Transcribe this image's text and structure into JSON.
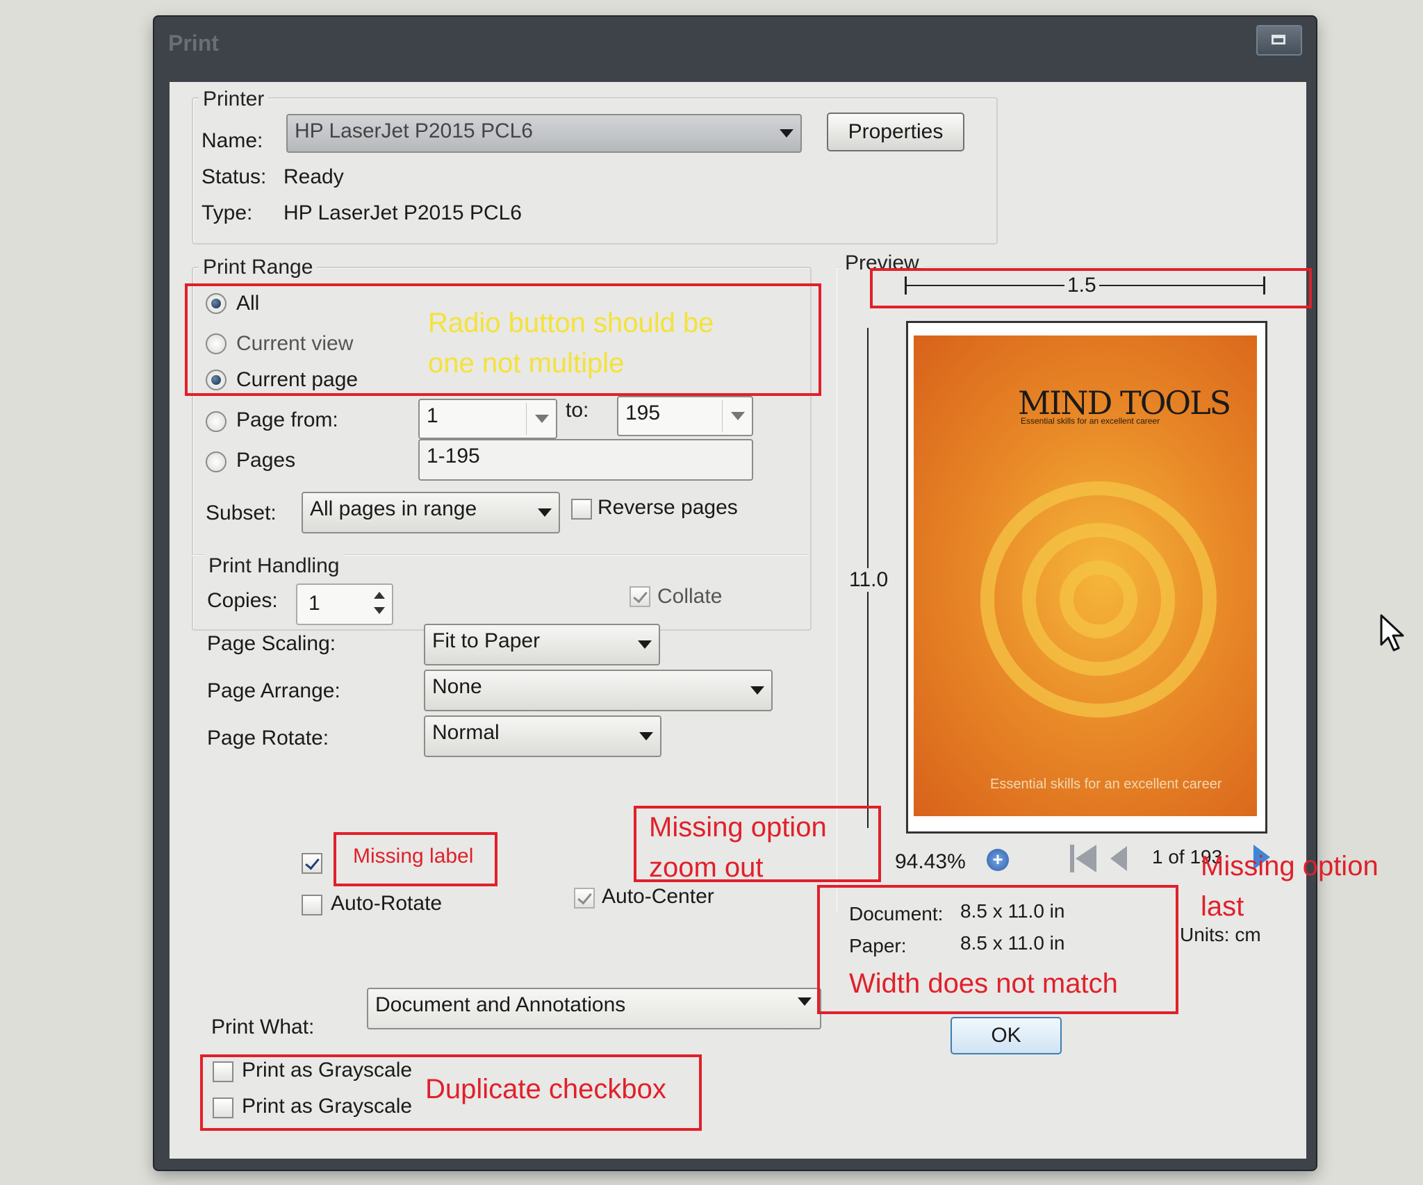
{
  "window": {
    "title": "Print"
  },
  "printer": {
    "group_title": "Printer",
    "name_label": "Name:",
    "name_value": "HP LaserJet P2015 PCL6",
    "properties_label": "Properties",
    "status_label": "Status:",
    "status_value": "Ready",
    "type_label": "Type:",
    "type_value": "HP LaserJet P2015 PCL6"
  },
  "print_range": {
    "group_title": "Print Range",
    "all_label": "All",
    "current_view_label": "Current view",
    "current_page_label": "Current page",
    "page_from_label": "Page from:",
    "page_from_value": "1",
    "to_label": "to:",
    "to_value": "195",
    "pages_label": "Pages",
    "pages_value": "1-195",
    "subset_label": "Subset:",
    "subset_value": "All pages in range",
    "reverse_label": "Reverse pages"
  },
  "print_handling": {
    "group_title": "Print Handling",
    "copies_label": "Copies:",
    "copies_value": "1",
    "collate_label": "Collate",
    "scaling_label": "Page Scaling:",
    "scaling_value": "Fit to Paper",
    "arrange_label": "Page Arrange:",
    "arrange_value": "None",
    "rotate_label": "Page Rotate:",
    "rotate_value": "Normal",
    "auto_rotate_label": "Auto-Rotate",
    "auto_center_label": "Auto-Center"
  },
  "print_what": {
    "label": "Print What:",
    "value": "Document and Annotations",
    "grayscale_1": "Print as Grayscale",
    "grayscale_2": "Print as Grayscale"
  },
  "preview": {
    "title": "Preview",
    "width_dim": "1.5",
    "height_dim": "11.0",
    "zoom": "94.43%",
    "page_counter": "1 of 193",
    "document_label": "Document:",
    "document_value": "8.5 x 11.0 in",
    "paper_label": "Paper:",
    "paper_value": "8.5 x 11.0 in",
    "units": "Units: cm",
    "cover_logo": "MIND TOOLS",
    "cover_tagline": "Essential skills for an excellent career",
    "cover_footer": "Essential skills for an excellent career"
  },
  "ok_label": "OK",
  "annotations": {
    "radio": "Radio button should be\none not multiple",
    "missing_label": "Missing label",
    "zoom_out": "Missing option\nzoom out",
    "last": "Missing option\nlast",
    "width": "Width does not match",
    "duplicate": "Duplicate checkbox"
  },
  "colors": {
    "annotation_red": "#e0202a",
    "annotation_yellow": "#f4e23a"
  }
}
